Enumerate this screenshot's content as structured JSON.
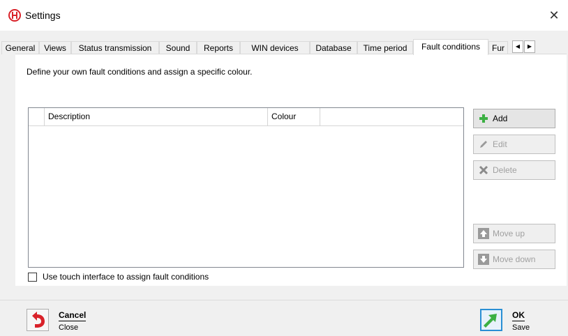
{
  "window": {
    "title": "Settings",
    "close_glyph": "✕"
  },
  "tabs": [
    {
      "label": "General"
    },
    {
      "label": "Views"
    },
    {
      "label": "Status transmission"
    },
    {
      "label": "Sound"
    },
    {
      "label": "Reports"
    },
    {
      "label": "WIN devices"
    },
    {
      "label": "Database"
    },
    {
      "label": "Time period"
    },
    {
      "label": "Fault conditions",
      "active": true
    },
    {
      "label": "Fur"
    }
  ],
  "page": {
    "intro": "Define your own fault conditions and assign a specific colour.",
    "grid": {
      "columns": [
        "",
        "Description",
        "Colour",
        ""
      ],
      "rows": []
    },
    "buttons": {
      "add": "Add",
      "edit": "Edit",
      "delete": "Delete",
      "move_up": "Move up",
      "move_down": "Move down"
    },
    "touch_checkbox": {
      "label": "Use touch interface to assign fault conditions",
      "checked": false
    }
  },
  "footer": {
    "cancel": {
      "label": "Cancel",
      "sub": "Close"
    },
    "ok": {
      "label": "OK",
      "sub": "Save"
    }
  },
  "colors": {
    "accent": "#2a8fd4",
    "ok_green": "#3cb043",
    "cancel_red": "#d9222a"
  }
}
